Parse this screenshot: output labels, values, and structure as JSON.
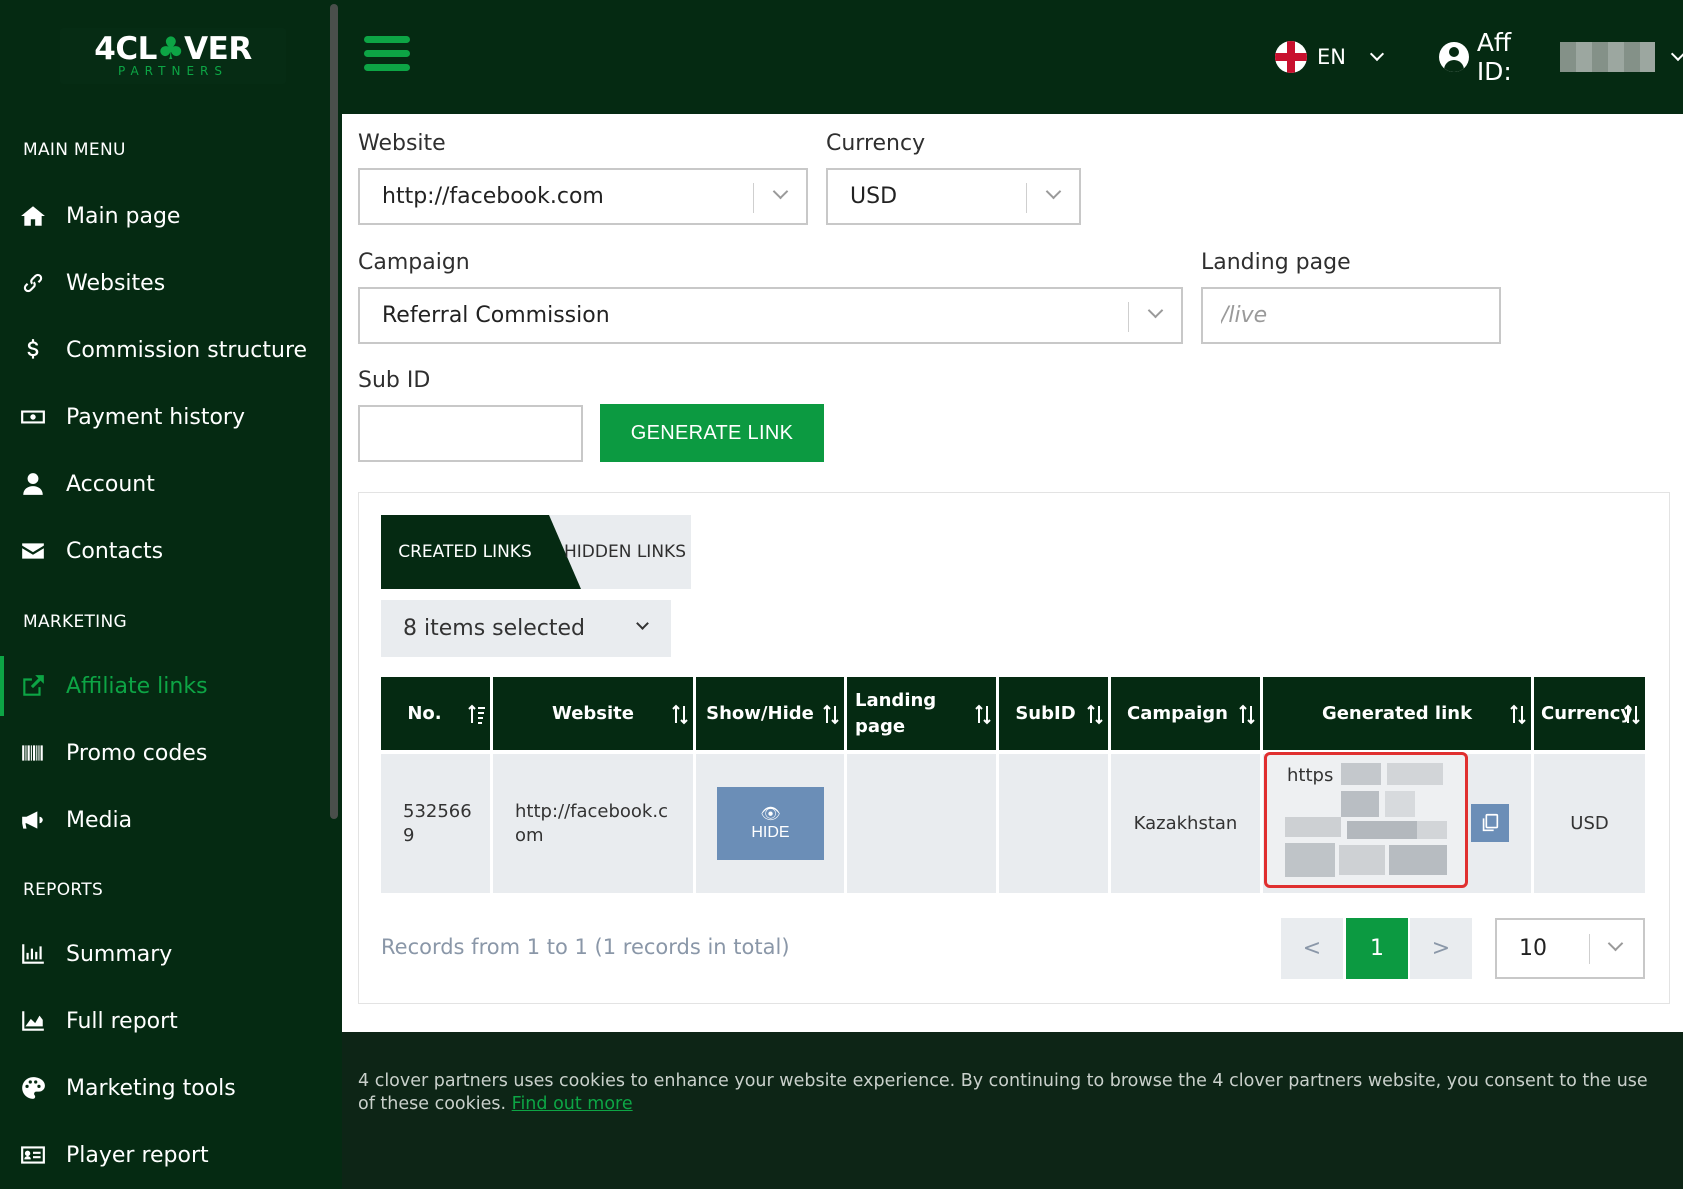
{
  "brand": {
    "logo_main": "4CL",
    "logo_clover": "♣",
    "logo_rest": "VER",
    "logo_sub": "PARTNERS"
  },
  "sidebar": {
    "sections": {
      "main": "MAIN MENU",
      "marketing": "MARKETING",
      "reports": "REPORTS"
    },
    "items": [
      {
        "label": "Main page",
        "icon": "home-icon"
      },
      {
        "label": "Websites",
        "icon": "link-icon"
      },
      {
        "label": "Commission structure",
        "icon": "dollar-icon"
      },
      {
        "label": "Payment history",
        "icon": "money-bill-icon"
      },
      {
        "label": "Account",
        "icon": "user-icon"
      },
      {
        "label": "Contacts",
        "icon": "envelope-icon"
      },
      {
        "label": "Affiliate links",
        "icon": "external-link-icon",
        "active": true
      },
      {
        "label": "Promo codes",
        "icon": "barcode-icon"
      },
      {
        "label": "Media",
        "icon": "megaphone-icon"
      },
      {
        "label": "Summary",
        "icon": "bar-chart-icon"
      },
      {
        "label": "Full report",
        "icon": "area-chart-icon"
      },
      {
        "label": "Marketing tools",
        "icon": "palette-icon"
      },
      {
        "label": "Player report",
        "icon": "id-card-icon"
      }
    ]
  },
  "header": {
    "lang": "EN",
    "aff_label": "Aff ID:"
  },
  "form": {
    "website_label": "Website",
    "website_value": "http://facebook.com",
    "currency_label": "Currency",
    "currency_value": "USD",
    "campaign_label": "Campaign",
    "campaign_value": "Referral Commission",
    "landing_label": "Landing page",
    "landing_placeholder": "/live",
    "subid_label": "Sub ID",
    "subid_value": "",
    "generate_label": "GENERATE LINK"
  },
  "tabs": {
    "created": "CREATED LINKS",
    "hidden": "HIDDEN LINKS"
  },
  "columns_select": "8 items selected",
  "table": {
    "headers": [
      "No.",
      "Website",
      "Show/Hide",
      "Landing page",
      "SubID",
      "Campaign",
      "Generated link",
      "Currency"
    ],
    "row": {
      "no": "5325669",
      "website": "http://facebook.com",
      "hide_label": "HIDE",
      "landing": "",
      "subid": "",
      "campaign": "Kazakhstan",
      "link_prefix": "https",
      "currency": "USD"
    }
  },
  "pagination": {
    "records_text": "Records from 1 to 1 (1 records in total)",
    "prev": "<",
    "current": "1",
    "next": ">",
    "per_page": "10"
  },
  "cookie": {
    "text": "4 clover partners uses cookies to enhance your website experience. By continuing to browse the 4 clover partners website, you consent to the use of these cookies.",
    "link": "Find out more"
  },
  "colors": {
    "brand_dark": "#052a12",
    "accent": "#0da545",
    "button": "#0c9a41",
    "hide_button": "#6b8eb7",
    "highlight": "#e03030"
  }
}
